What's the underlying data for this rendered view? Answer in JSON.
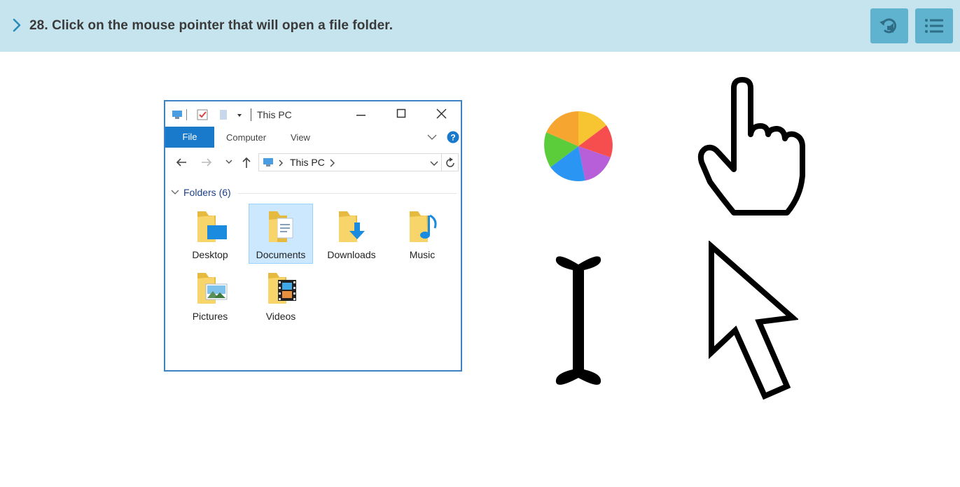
{
  "header": {
    "question": "28. Click on the mouse pointer that will open a file folder.",
    "replay_icon": "replay-audio-icon",
    "menu_icon": "list-menu-icon",
    "colors": {
      "bar": "#c5e4ed",
      "button": "#5fb3cf",
      "chevron": "#2a8ab8"
    }
  },
  "explorer": {
    "title": "This PC",
    "ribbon_tabs": [
      "File",
      "Computer",
      "View"
    ],
    "address": "This PC",
    "group_label": "Folders (6)",
    "folders": [
      {
        "label": "Desktop",
        "icon": "desktop-folder-icon"
      },
      {
        "label": "Documents",
        "icon": "documents-folder-icon",
        "selected": true
      },
      {
        "label": "Downloads",
        "icon": "downloads-folder-icon"
      },
      {
        "label": "Music",
        "icon": "music-folder-icon"
      },
      {
        "label": "Pictures",
        "icon": "pictures-folder-icon"
      },
      {
        "label": "Videos",
        "icon": "videos-folder-icon"
      }
    ]
  },
  "choices": [
    {
      "name": "spinning-wheel-cursor-icon"
    },
    {
      "name": "hand-pointer-cursor-icon"
    },
    {
      "name": "text-ibeam-cursor-icon"
    },
    {
      "name": "arrow-pointer-cursor-icon"
    }
  ]
}
